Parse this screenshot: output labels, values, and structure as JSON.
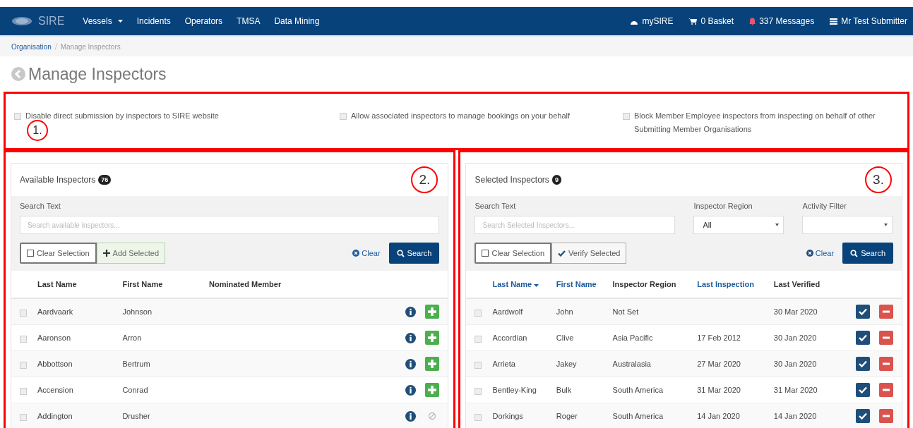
{
  "navbar": {
    "brand": "SIRE",
    "menu": [
      {
        "label": "Vessels",
        "dropdown": true
      },
      {
        "label": "Incidents",
        "dropdown": false
      },
      {
        "label": "Operators",
        "dropdown": false
      },
      {
        "label": "TMSA",
        "dropdown": false
      },
      {
        "label": "Data Mining",
        "dropdown": false
      }
    ],
    "right": [
      {
        "kind": "dashboard",
        "label": "mySIRE"
      },
      {
        "kind": "cart",
        "label": "0 Basket"
      },
      {
        "kind": "bell",
        "label": "337 Messages"
      },
      {
        "kind": "menu",
        "label": "Mr Test Submitter"
      }
    ]
  },
  "breadcrumb": [
    {
      "label": "Organisation",
      "link": true
    },
    {
      "label": "Manage Inspectors",
      "link": false
    }
  ],
  "page_title": "Manage Inspectors",
  "annotations": [
    "1.",
    "2.",
    "3."
  ],
  "options": [
    {
      "label": "Disable direct submission by inspectors to SIRE website",
      "checked": false
    },
    {
      "label": "Allow associated inspectors to manage bookings on your behalf",
      "checked": false
    },
    {
      "label": "Block Member Employee inspectors from inspecting on behalf of other Submitting Member Organisations",
      "checked": false
    }
  ],
  "available": {
    "title": "Available Inspectors",
    "count": "76",
    "search_label": "Search Text",
    "search_placeholder": "Search available inspectors...",
    "clear_selection": "Clear Selection",
    "add_selected": "Add Selected",
    "clear": "Clear",
    "search": "Search",
    "columns": [
      "Last Name",
      "First Name",
      "Nominated Member"
    ],
    "rows": [
      {
        "last": "Aardvaark",
        "first": "Johnson",
        "checked": false,
        "addable": true
      },
      {
        "last": "Aaronson",
        "first": "Arron",
        "checked": false,
        "addable": true
      },
      {
        "last": "Abbottson",
        "first": "Bertrum",
        "checked": false,
        "addable": true
      },
      {
        "last": "Accension",
        "first": "Conrad",
        "checked": false,
        "addable": true
      },
      {
        "last": "Addington",
        "first": "Drusher",
        "checked": false,
        "addable": false
      }
    ]
  },
  "selected": {
    "title": "Selected Inspectors",
    "count": "9",
    "search_label": "Search Text",
    "search_placeholder": "Search Selected Inspectors...",
    "region_label": "Inspector Region",
    "region_value": "All",
    "activity_label": "Activity Filter",
    "clear_selection": "Clear Selection",
    "verify_selected": "Verify Selected",
    "clear": "Clear",
    "search": "Search",
    "columns": [
      {
        "label": "Last Name",
        "sortable": true,
        "sorted": true
      },
      {
        "label": "First Name",
        "sortable": true,
        "sorted": false
      },
      {
        "label": "Inspector Region",
        "sortable": false,
        "sorted": false
      },
      {
        "label": "Last Inspection",
        "sortable": true,
        "sorted": false
      },
      {
        "label": "Last Verified",
        "sortable": false,
        "sorted": false
      }
    ],
    "rows": [
      {
        "last": "Aardwolf",
        "first": "John",
        "region": "Not Set",
        "inspection": "",
        "verified": "30 Mar 2020",
        "checked": false
      },
      {
        "last": "Accordian",
        "first": "Clive",
        "region": "Asia Pacific",
        "inspection": "17 Feb 2012",
        "verified": "30 Jan 2020",
        "checked": false
      },
      {
        "last": "Arrieta",
        "first": "Jakey",
        "region": "Australasia",
        "inspection": "27 Mar 2020",
        "verified": "30 Jan 2020",
        "checked": false
      },
      {
        "last": "Bentley-King",
        "first": "Bulk",
        "region": "South America",
        "inspection": "31 Mar 2020",
        "verified": "31 Mar 2020",
        "checked": false
      },
      {
        "last": "Dorkings",
        "first": "Roger",
        "region": "South America",
        "inspection": "14 Jan 2020",
        "verified": "14 Jan 2020",
        "checked": false
      }
    ]
  }
}
